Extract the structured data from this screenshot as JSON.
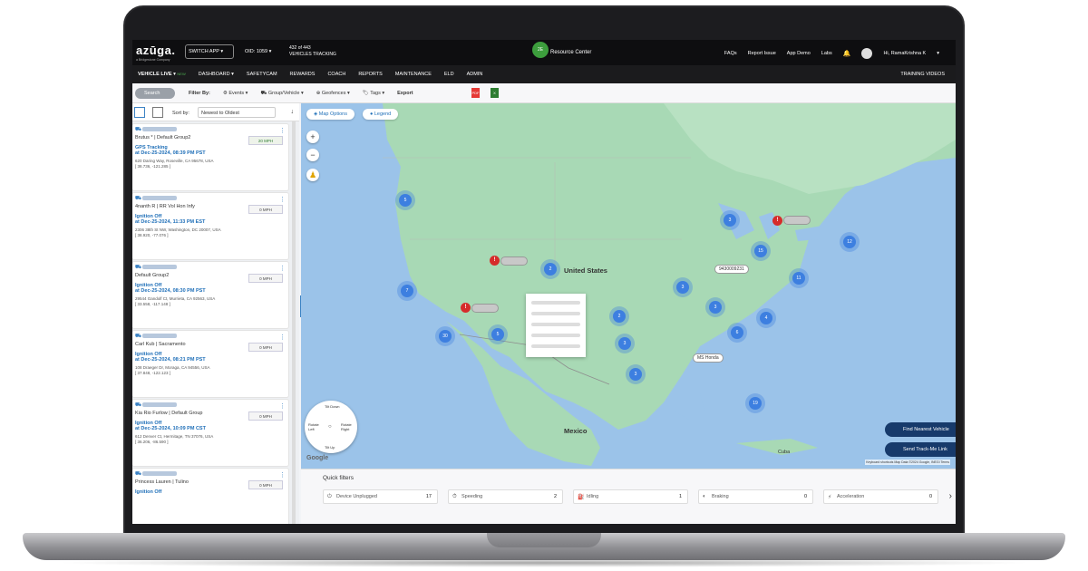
{
  "topbar": {
    "logo": "azūga.",
    "logo_sub": "a Bridgestone Company",
    "switch_app": "SWITCH APP",
    "oid": "OID: 1059",
    "vehicles_count": "432 of 443",
    "vehicles_label": "VEHICLES TRACKING",
    "resource_badge": "2E",
    "resource_center": "Resource Center",
    "links": [
      "FAQs",
      "Report Issue",
      "App Demo",
      "Labs"
    ],
    "user": "Hi, RamaKrishna K"
  },
  "nav": {
    "items": [
      "VEHICLE LIVE",
      "DASHBOARD",
      "SAFETYCAM",
      "REWARDS",
      "COACH",
      "REPORTS",
      "MAINTENANCE",
      "ELD",
      "ADMIN"
    ],
    "new_badge": "NEW",
    "training": "TRAINING VIDEOS"
  },
  "filterbar": {
    "search": "Search",
    "filter_by": "Filter By:",
    "filters": [
      "Events",
      "Group/Vehicle",
      "Geofences",
      "Tags"
    ],
    "export": "Export"
  },
  "list": {
    "sort_label": "Sort by:",
    "sort_value": "Newest to Oldest",
    "vehicles": [
      {
        "group": "Brutus * | Default Group2",
        "status": "GPS Tracking",
        "time": "at Dec-25-2024, 08:39 PM PST",
        "address": "620 Daring Way, Roseville, CA 95678, USA",
        "coords": "[ 38.736, -121.285 ]",
        "speed": "20 MPH",
        "moving": true
      },
      {
        "group": "4nanth R | RR Vol Hon Infy",
        "status": "Ignition Off",
        "time": "at Dec-25-2024, 11:33 PM EST",
        "address": "2306 38th St NW, Washington, DC 20007, USA",
        "coords": "[ 38.920, -77.076 ]",
        "speed": "0 MPH",
        "moving": false
      },
      {
        "group": "Default Group2",
        "status": "Ignition Off",
        "time": "at Dec-25-2024, 08:30 PM PST",
        "address": "29544 Gandolf Ct, Murrieta, CA 92563, USA",
        "coords": "[ 33.558, -117.148 ]",
        "speed": "0 MPH",
        "moving": false
      },
      {
        "group": "Carl Kub | Sacramento",
        "status": "Ignition Off",
        "time": "at Dec-25-2024, 08:21 PM PST",
        "address": "108 Draeger Dr, Moraga, CA 94556, USA",
        "coords": "[ 37.848, -122.123 ]",
        "speed": "0 MPH",
        "moving": false
      },
      {
        "group": "Kia Rio Furlow | Default Group",
        "status": "Ignition Off",
        "time": "at Dec-25-2024, 10:09 PM CST",
        "address": "612 Denver Ct, Hermitage, TN 37076, USA",
        "coords": "[ 36.206, -86.590 ]",
        "speed": "0 MPH",
        "moving": false
      },
      {
        "group": "Princess Lauren | Tulino",
        "status": "Ignition Off",
        "time": "",
        "address": "",
        "coords": "",
        "speed": "0 MPH",
        "moving": false
      }
    ]
  },
  "map": {
    "map_options": "Map Options",
    "legend": "Legend",
    "labels": {
      "us": "United States",
      "mexico": "Mexico",
      "cuba": "Cuba",
      "tag1": "9430009231",
      "tag2": "MS Honda",
      "google": "Google"
    },
    "clusters": [
      "5",
      "3",
      "2",
      "7",
      "30",
      "5",
      "2",
      "3",
      "3",
      "3",
      "6",
      "4",
      "3",
      "11",
      "15",
      "19",
      "12"
    ],
    "alerts": [
      "!",
      "!",
      "!"
    ],
    "actions": [
      "Find Nearest Vehicle",
      "Send Track-Me Link"
    ],
    "footer": "Keyboard shortcuts   Map Data ©2024 Google, INEGI   Terms",
    "compass": {
      "top": "Tilt Down",
      "left": "Rotate Left",
      "right": "Rotate Right",
      "bottom": "Tilt Up"
    }
  },
  "quick_filters": {
    "title": "Quick filters",
    "items": [
      {
        "label": "Device Unplugged",
        "count": "17"
      },
      {
        "label": "Speeding",
        "count": "2"
      },
      {
        "label": "Idling",
        "count": "1"
      },
      {
        "label": "Braking",
        "count": "0"
      },
      {
        "label": "Acceleration",
        "count": "0"
      }
    ]
  },
  "colors": {
    "accent": "#3b82c4",
    "navbar": "#0e0e10",
    "alert": "#d62b2b",
    "cluster": "#3d7fe0"
  }
}
